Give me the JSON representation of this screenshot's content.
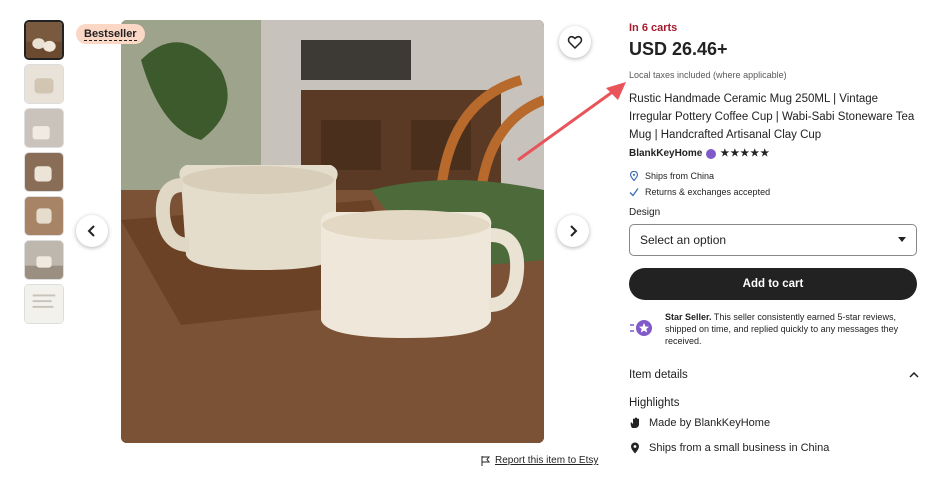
{
  "badge": {
    "label": "Bestseller"
  },
  "listing": {
    "in_carts": "In 6 carts",
    "price": "USD 26.46+",
    "taxes_note": "Local taxes included (where applicable)",
    "title": "Rustic Handmade Ceramic Mug 250ML | Vintage Irregular Pottery Coffee Cup | Wabi-Sabi Stoneware Tea Mug | Handcrafted Artisanal Clay Cup",
    "seller_name": "BlankKeyHome",
    "stars": "★★★★★",
    "ships_from": "Ships from China",
    "returns": "Returns & exchanges accepted"
  },
  "variation": {
    "label": "Design",
    "selected": "Select an option"
  },
  "actions": {
    "add_to_cart": "Add to cart",
    "report": "Report this item to Etsy"
  },
  "star_seller": {
    "bold": "Star Seller.",
    "text": " This seller consistently earned 5-star reviews, shipped on time, and replied quickly to any messages they received."
  },
  "details": {
    "item_details": "Item details",
    "highlights": "Highlights",
    "made_by": "Made by ",
    "made_by_seller": "BlankKeyHome",
    "ships_small": "Ships from a small business in China"
  },
  "colors": {
    "accent_red": "#a61a2e",
    "badge_bg": "#fbd7c6",
    "button_dark": "#222222",
    "star_seller_purple": "#7f5ac8",
    "arrow": "#e8545a"
  },
  "icons": [
    "heart-icon",
    "chevron-left-icon",
    "chevron-right-icon",
    "flag-icon",
    "location-pin-icon",
    "checkmark-icon",
    "caret-down-icon",
    "chevron-up-icon",
    "hand-wave-icon",
    "star-seller-icon"
  ]
}
